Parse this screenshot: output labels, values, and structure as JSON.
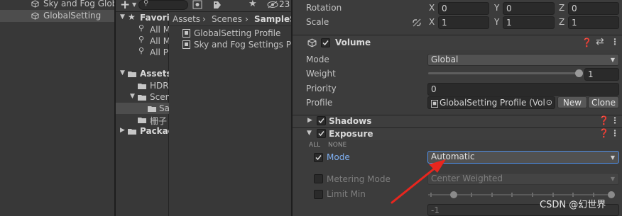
{
  "hierarchy": {
    "items": [
      {
        "label": "Sky and Fog Glob",
        "selected": false
      },
      {
        "label": "GlobalSetting",
        "selected": true
      }
    ]
  },
  "project": {
    "toolbar": {
      "add_label": "+",
      "search_value": "",
      "count_label": "23"
    },
    "tree": [
      {
        "label": "Favorit",
        "type": "favorites"
      },
      {
        "label": "All M",
        "type": "search"
      },
      {
        "label": "All M",
        "type": "search"
      },
      {
        "label": "All P",
        "type": "search"
      },
      {
        "label": "Assets",
        "type": "folder-open"
      },
      {
        "label": "HDR",
        "type": "folder"
      },
      {
        "label": "Scen",
        "type": "folder-open"
      },
      {
        "label": "Sa",
        "type": "folder",
        "selected": true
      },
      {
        "label": "栅子",
        "type": "folder"
      },
      {
        "label": "Packag",
        "type": "folder"
      }
    ],
    "breadcrumb": [
      "Assets",
      "Scenes",
      "SampleS"
    ],
    "files": [
      "GlobalSetting Profile",
      "Sky and Fog Settings Pro"
    ]
  },
  "inspector": {
    "transform": {
      "rotation_label": "Rotation",
      "rotation": {
        "x": "0",
        "y": "0",
        "z": "0"
      },
      "scale_label": "Scale",
      "scale": {
        "x": "1",
        "y": "1",
        "z": "1"
      },
      "axis_x": "X",
      "axis_y": "Y",
      "axis_z": "Z"
    },
    "volume": {
      "title": "Volume",
      "mode_label": "Mode",
      "mode_value": "Global",
      "weight_label": "Weight",
      "weight_value": "1",
      "weight_fraction": 1.0,
      "priority_label": "Priority",
      "priority_value": "0",
      "profile_label": "Profile",
      "profile_value": "GlobalSetting Profile (Volu",
      "new_label": "New",
      "clone_label": "Clone"
    },
    "shadows": {
      "title": "Shadows"
    },
    "exposure": {
      "title": "Exposure",
      "all_label": "ALL",
      "none_label": "NONE",
      "mode_label": "Mode",
      "mode_value": "Automatic",
      "metering_label": "Metering Mode",
      "metering_value": "Center Weighted",
      "limit_min_label": "Limit Min",
      "limit_min_value": "-1"
    }
  },
  "watermark": "CSDN @幻世界",
  "colors": {
    "accent": "#4d8ee8",
    "arrow": "#e8261e",
    "selected_row": "#4d4d4d"
  }
}
